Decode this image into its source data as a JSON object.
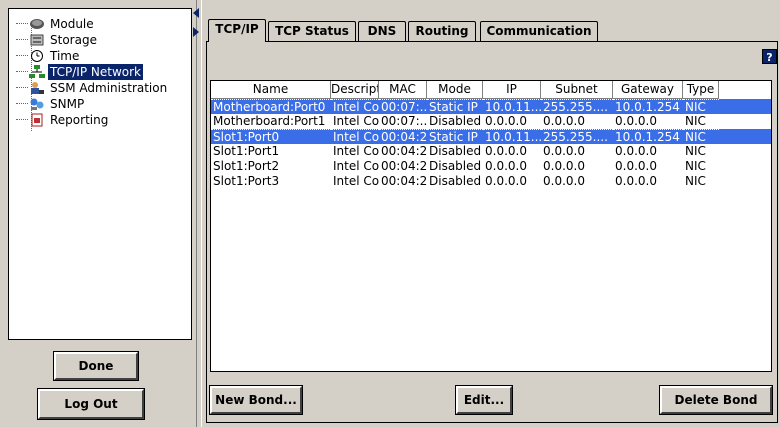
{
  "tree": {
    "items": [
      {
        "label": "Module",
        "icon": "module-icon"
      },
      {
        "label": "Storage",
        "icon": "storage-icon"
      },
      {
        "label": "Time",
        "icon": "clock-icon"
      },
      {
        "label": "TCP/IP Network",
        "icon": "network-icon",
        "selected": true
      },
      {
        "label": "SSM Administration",
        "icon": "user-admin-icon"
      },
      {
        "label": "SNMP",
        "icon": "snmp-icon"
      },
      {
        "label": "Reporting",
        "icon": "report-icon"
      }
    ]
  },
  "left_buttons": {
    "done": "Done",
    "logout": "Log Out"
  },
  "tabs": [
    {
      "label": "TCP/IP",
      "active": true
    },
    {
      "label": "TCP Status",
      "active": false
    },
    {
      "label": "DNS",
      "active": false
    },
    {
      "label": "Routing",
      "active": false
    },
    {
      "label": "Communication",
      "active": false
    }
  ],
  "help_icon": "?",
  "table": {
    "columns": [
      "Name",
      "Descript...",
      "MAC",
      "Mode",
      "IP",
      "Subnet",
      "Gateway",
      "Type"
    ],
    "rows": [
      {
        "cells": [
          "Motherboard:Port0",
          "Intel Co...",
          "00:07:...",
          "Static IP",
          "10.0.11...",
          "255.255....",
          "10.0.1.254",
          "NIC"
        ],
        "selected": true
      },
      {
        "cells": [
          "Motherboard:Port1",
          "Intel Co...",
          "00:07:...",
          "Disabled",
          "0.0.0.0",
          "0.0.0.0",
          "0.0.0.0",
          "NIC"
        ],
        "selected": false
      },
      {
        "cells": [
          "Slot1:Port0",
          "Intel Co...",
          "00:04:2...",
          "Static IP",
          "10.0.11...",
          "255.255....",
          "10.0.1.254",
          "NIC"
        ],
        "selected": true
      },
      {
        "cells": [
          "Slot1:Port1",
          "Intel Co...",
          "00:04:2...",
          "Disabled",
          "0.0.0.0",
          "0.0.0.0",
          "0.0.0.0",
          "NIC"
        ],
        "selected": false
      },
      {
        "cells": [
          "Slot1:Port2",
          "Intel Co...",
          "00:04:2...",
          "Disabled",
          "0.0.0.0",
          "0.0.0.0",
          "0.0.0.0",
          "NIC"
        ],
        "selected": false
      },
      {
        "cells": [
          "Slot1:Port3",
          "Intel Co...",
          "00:04:2...",
          "Disabled",
          "0.0.0.0",
          "0.0.0.0",
          "0.0.0.0",
          "NIC"
        ],
        "selected": false
      }
    ]
  },
  "actions": {
    "new_bond": "New Bond...",
    "edit": "Edit...",
    "delete_bond": "Delete Bond"
  },
  "colors": {
    "selection": "#3a6ee8",
    "tree_selection": "#0a246a",
    "panel": "#d4d0c8"
  }
}
